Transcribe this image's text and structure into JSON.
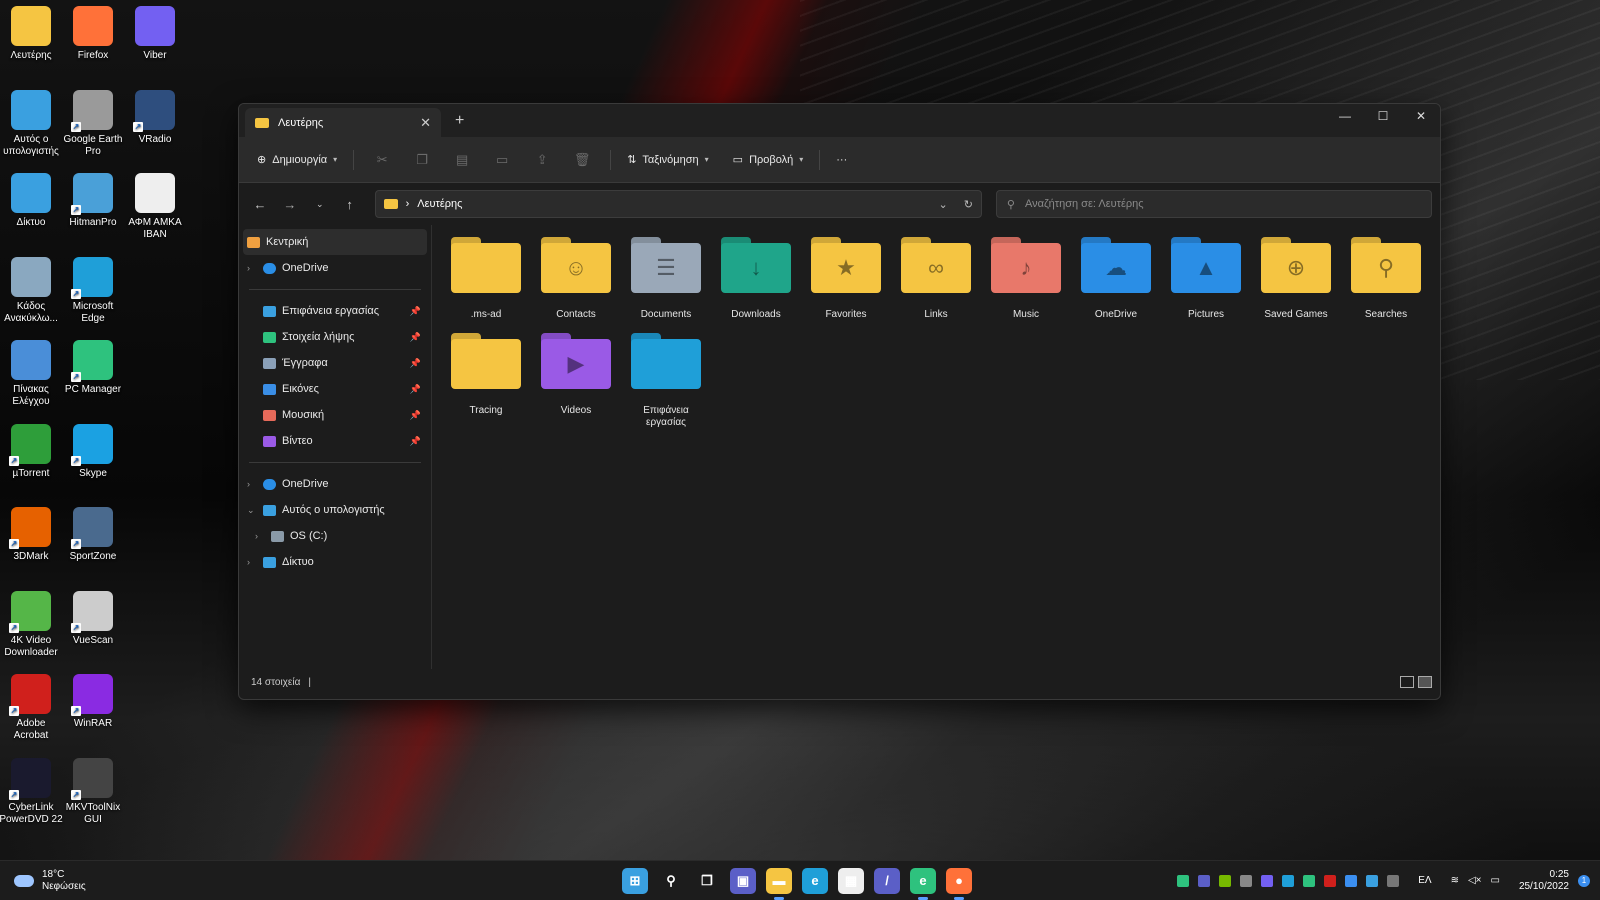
{
  "desktop": {
    "icons": [
      {
        "label": "Λευτέρης",
        "icon": "user-folder-icon",
        "color": "#f5c542"
      },
      {
        "label": "Firefox",
        "icon": "firefox-icon",
        "color": "#ff7139"
      },
      {
        "label": "Viber",
        "icon": "viber-icon",
        "color": "#7360f2"
      },
      {
        "label": "Αυτός ο υπολογιστής",
        "icon": "this-pc-icon",
        "color": "#3aa0e0"
      },
      {
        "label": "Google Earth Pro",
        "icon": "google-earth-icon",
        "color": "#9a9a9a"
      },
      {
        "label": "VRadio",
        "icon": "vradio-icon",
        "color": "#2e4e7e"
      },
      {
        "label": "Δίκτυο",
        "icon": "network-icon",
        "color": "#3aa0e0"
      },
      {
        "label": "HitmanPro",
        "icon": "hitmanpro-icon",
        "color": "#4aa0d8"
      },
      {
        "label": "ΑΦΜ ΑΜΚΑ ΙΒΑΝ",
        "icon": "document-icon",
        "color": "#eeeeee"
      },
      {
        "label": "Κάδος Ανακύκλω...",
        "icon": "recycle-bin-icon",
        "color": "#8aa8c0"
      },
      {
        "label": "Microsoft Edge",
        "icon": "edge-icon",
        "color": "#1f9fd8"
      },
      {
        "label": "Πίνακας Ελέγχου",
        "icon": "control-panel-icon",
        "color": "#4a8ed8"
      },
      {
        "label": "PC Manager",
        "icon": "pc-manager-icon",
        "color": "#2ec27e"
      },
      {
        "label": "µTorrent",
        "icon": "utorrent-icon",
        "color": "#2e9e3a"
      },
      {
        "label": "Skype",
        "icon": "skype-icon",
        "color": "#1ba1e2"
      },
      {
        "label": "3DMark",
        "icon": "3dmark-icon",
        "color": "#e66100"
      },
      {
        "label": "SportZone",
        "icon": "sportzone-icon",
        "color": "#4a6a8e"
      },
      {
        "label": "4K Video Downloader",
        "icon": "4k-downloader-icon",
        "color": "#55b648"
      },
      {
        "label": "VueScan",
        "icon": "vuescan-icon",
        "color": "#cccccc"
      },
      {
        "label": "Adobe Acrobat",
        "icon": "acrobat-icon",
        "color": "#d0201c"
      },
      {
        "label": "WinRAR",
        "icon": "winrar-icon",
        "color": "#8a2be2"
      },
      {
        "label": "CyberLink PowerDVD 22",
        "icon": "powerdvd-icon",
        "color": "#1a1a2e"
      },
      {
        "label": "MKVToolNix GUI",
        "icon": "mkvtoolnix-icon",
        "color": "#444444"
      }
    ]
  },
  "window": {
    "tab_title": "Λευτέρης",
    "new_tab": "+",
    "toolbar": {
      "new_label": "Δημιουργία",
      "sort_label": "Ταξινόμηση",
      "view_label": "Προβολή",
      "more_label": "···"
    },
    "address": {
      "path": "Λευτέρης",
      "separator": "›"
    },
    "search": {
      "placeholder": "Αναζήτηση σε: Λευτέρης"
    },
    "nav": {
      "home": "Κεντρική",
      "onedrive_top": "OneDrive",
      "quick": [
        {
          "label": "Επιφάνεια εργασίας",
          "icon": "desktop-icon",
          "color": "#3aa0e0"
        },
        {
          "label": "Στοιχεία λήψης",
          "icon": "downloads-icon",
          "color": "#2ec27e"
        },
        {
          "label": "Έγγραφα",
          "icon": "documents-icon",
          "color": "#8aa0b8"
        },
        {
          "label": "Εικόνες",
          "icon": "pictures-icon",
          "color": "#3a8ee6"
        },
        {
          "label": "Μουσική",
          "icon": "music-icon",
          "color": "#e66a5a"
        },
        {
          "label": "Βίντεο",
          "icon": "videos-icon",
          "color": "#9a5ae6"
        }
      ],
      "onedrive": "OneDrive",
      "this_pc": "Αυτός ο υπολογιστής",
      "drive": "OS (C:)",
      "network": "Δίκτυο"
    },
    "files": [
      {
        "name": ".ms-ad",
        "icon": "folder-icon",
        "color": "#f5c542",
        "glyph": ""
      },
      {
        "name": "Contacts",
        "icon": "contacts-folder-icon",
        "color": "#f5c542",
        "glyph": "☺"
      },
      {
        "name": "Documents",
        "icon": "documents-folder-icon",
        "color": "#9aa8b8",
        "glyph": "☰"
      },
      {
        "name": "Downloads",
        "icon": "downloads-folder-icon",
        "color": "#1fa58a",
        "glyph": "↓"
      },
      {
        "name": "Favorites",
        "icon": "favorites-folder-icon",
        "color": "#f5c542",
        "glyph": "★"
      },
      {
        "name": "Links",
        "icon": "links-folder-icon",
        "color": "#f5c542",
        "glyph": "∞"
      },
      {
        "name": "Music",
        "icon": "music-folder-icon",
        "color": "#e8786a",
        "glyph": "♪"
      },
      {
        "name": "OneDrive",
        "icon": "onedrive-folder-icon",
        "color": "#2a8ee6",
        "glyph": "☁"
      },
      {
        "name": "Pictures",
        "icon": "pictures-folder-icon",
        "color": "#2a8ee6",
        "glyph": "▲"
      },
      {
        "name": "Saved Games",
        "icon": "saved-games-folder-icon",
        "color": "#f5c542",
        "glyph": "⊕"
      },
      {
        "name": "Searches",
        "icon": "searches-folder-icon",
        "color": "#f5c542",
        "glyph": "⚲"
      },
      {
        "name": "Tracing",
        "icon": "folder-icon",
        "color": "#f5c542",
        "glyph": ""
      },
      {
        "name": "Videos",
        "icon": "videos-folder-icon",
        "color": "#9a5ae6",
        "glyph": "▶"
      },
      {
        "name": "Επιφάνεια εργασίας",
        "icon": "desktop-folder-icon",
        "color": "#1f9fd8",
        "glyph": ""
      }
    ],
    "status": {
      "count": "14 στοιχεία",
      "cursor": "|"
    }
  },
  "taskbar": {
    "weather": {
      "temp": "18°C",
      "desc": "Νεφώσεις"
    },
    "apps": [
      {
        "name": "start-icon",
        "color": "#3aa0e0",
        "glyph": "⊞",
        "active": false
      },
      {
        "name": "search-icon",
        "color": "#1c1c1c",
        "glyph": "⚲",
        "active": false
      },
      {
        "name": "task-view-icon",
        "color": "#1c1c1c",
        "glyph": "❐",
        "active": false
      },
      {
        "name": "teams-chat-icon",
        "color": "#5b5fc7",
        "glyph": "▣",
        "active": false
      },
      {
        "name": "file-explorer-icon",
        "color": "#f5c542",
        "glyph": "▬",
        "active": true
      },
      {
        "name": "edge-icon",
        "color": "#1f9fd8",
        "glyph": "e",
        "active": false
      },
      {
        "name": "store-icon",
        "color": "#eeeeee",
        "glyph": "▦",
        "active": false
      },
      {
        "name": "visual-studio-icon",
        "color": "#5b5fc7",
        "glyph": "/",
        "active": false
      },
      {
        "name": "edge-dev-icon",
        "color": "#2ec27e",
        "glyph": "e",
        "active": true
      },
      {
        "name": "firefox-icon",
        "color": "#ff7139",
        "glyph": "●",
        "active": true
      }
    ],
    "lang": "ΕΛ",
    "time": "0:25",
    "date": "25/10/2022",
    "notifications": "1"
  }
}
